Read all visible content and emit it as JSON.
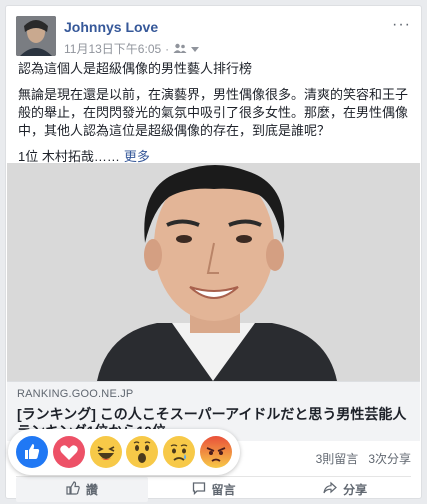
{
  "post": {
    "author": "Johnnys Love",
    "timestamp": "11月13日下午6:05",
    "dot": "·",
    "audience_icon": "friends-icon",
    "more_label": "···",
    "title_line": "認為這個人是超級偶像的男性藝人排行榜",
    "body_line": "無論是現在還是以前，在演藝界，男性偶像很多。清爽的笑容和王子般的舉止，在閃閃發光的氣氛中吸引了很多女性。那麼，在男性偶像中，其他人認為這位是超級偶像的存在，到底是誰呢？",
    "rank_line": "1位 木村拓哉……",
    "see_more": "更多"
  },
  "link": {
    "domain": "RANKING.GOO.NE.JP",
    "title": "[ランキング] この人こそスーパーアイドルだと思う男性芸能人ランキング1位から10位"
  },
  "stats": {
    "comments": "3則留言",
    "shares": "3次分享"
  },
  "actions": {
    "like": "讚",
    "comment": "留言",
    "share": "分享"
  },
  "reactions": [
    "like",
    "love",
    "haha",
    "wow",
    "sad",
    "angry"
  ],
  "colors": {
    "brand": "#365899",
    "like": "#2078f4",
    "love": "#ed5167",
    "emoji": "#f7c948",
    "angry": "#e9503a"
  }
}
